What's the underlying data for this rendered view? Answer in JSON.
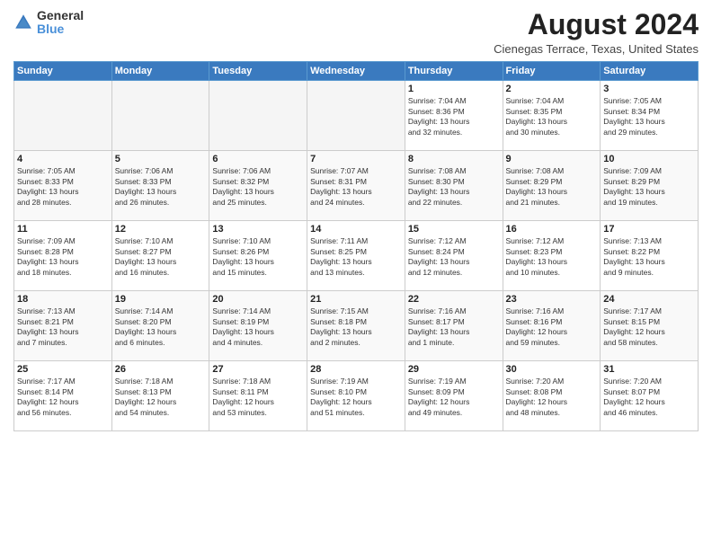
{
  "logo": {
    "general": "General",
    "blue": "Blue"
  },
  "header": {
    "month": "August 2024",
    "location": "Cienegas Terrace, Texas, United States"
  },
  "weekdays": [
    "Sunday",
    "Monday",
    "Tuesday",
    "Wednesday",
    "Thursday",
    "Friday",
    "Saturday"
  ],
  "weeks": [
    [
      {
        "day": "",
        "info": ""
      },
      {
        "day": "",
        "info": ""
      },
      {
        "day": "",
        "info": ""
      },
      {
        "day": "",
        "info": ""
      },
      {
        "day": "1",
        "info": "Sunrise: 7:04 AM\nSunset: 8:36 PM\nDaylight: 13 hours\nand 32 minutes."
      },
      {
        "day": "2",
        "info": "Sunrise: 7:04 AM\nSunset: 8:35 PM\nDaylight: 13 hours\nand 30 minutes."
      },
      {
        "day": "3",
        "info": "Sunrise: 7:05 AM\nSunset: 8:34 PM\nDaylight: 13 hours\nand 29 minutes."
      }
    ],
    [
      {
        "day": "4",
        "info": "Sunrise: 7:05 AM\nSunset: 8:33 PM\nDaylight: 13 hours\nand 28 minutes."
      },
      {
        "day": "5",
        "info": "Sunrise: 7:06 AM\nSunset: 8:33 PM\nDaylight: 13 hours\nand 26 minutes."
      },
      {
        "day": "6",
        "info": "Sunrise: 7:06 AM\nSunset: 8:32 PM\nDaylight: 13 hours\nand 25 minutes."
      },
      {
        "day": "7",
        "info": "Sunrise: 7:07 AM\nSunset: 8:31 PM\nDaylight: 13 hours\nand 24 minutes."
      },
      {
        "day": "8",
        "info": "Sunrise: 7:08 AM\nSunset: 8:30 PM\nDaylight: 13 hours\nand 22 minutes."
      },
      {
        "day": "9",
        "info": "Sunrise: 7:08 AM\nSunset: 8:29 PM\nDaylight: 13 hours\nand 21 minutes."
      },
      {
        "day": "10",
        "info": "Sunrise: 7:09 AM\nSunset: 8:29 PM\nDaylight: 13 hours\nand 19 minutes."
      }
    ],
    [
      {
        "day": "11",
        "info": "Sunrise: 7:09 AM\nSunset: 8:28 PM\nDaylight: 13 hours\nand 18 minutes."
      },
      {
        "day": "12",
        "info": "Sunrise: 7:10 AM\nSunset: 8:27 PM\nDaylight: 13 hours\nand 16 minutes."
      },
      {
        "day": "13",
        "info": "Sunrise: 7:10 AM\nSunset: 8:26 PM\nDaylight: 13 hours\nand 15 minutes."
      },
      {
        "day": "14",
        "info": "Sunrise: 7:11 AM\nSunset: 8:25 PM\nDaylight: 13 hours\nand 13 minutes."
      },
      {
        "day": "15",
        "info": "Sunrise: 7:12 AM\nSunset: 8:24 PM\nDaylight: 13 hours\nand 12 minutes."
      },
      {
        "day": "16",
        "info": "Sunrise: 7:12 AM\nSunset: 8:23 PM\nDaylight: 13 hours\nand 10 minutes."
      },
      {
        "day": "17",
        "info": "Sunrise: 7:13 AM\nSunset: 8:22 PM\nDaylight: 13 hours\nand 9 minutes."
      }
    ],
    [
      {
        "day": "18",
        "info": "Sunrise: 7:13 AM\nSunset: 8:21 PM\nDaylight: 13 hours\nand 7 minutes."
      },
      {
        "day": "19",
        "info": "Sunrise: 7:14 AM\nSunset: 8:20 PM\nDaylight: 13 hours\nand 6 minutes."
      },
      {
        "day": "20",
        "info": "Sunrise: 7:14 AM\nSunset: 8:19 PM\nDaylight: 13 hours\nand 4 minutes."
      },
      {
        "day": "21",
        "info": "Sunrise: 7:15 AM\nSunset: 8:18 PM\nDaylight: 13 hours\nand 2 minutes."
      },
      {
        "day": "22",
        "info": "Sunrise: 7:16 AM\nSunset: 8:17 PM\nDaylight: 13 hours\nand 1 minute."
      },
      {
        "day": "23",
        "info": "Sunrise: 7:16 AM\nSunset: 8:16 PM\nDaylight: 12 hours\nand 59 minutes."
      },
      {
        "day": "24",
        "info": "Sunrise: 7:17 AM\nSunset: 8:15 PM\nDaylight: 12 hours\nand 58 minutes."
      }
    ],
    [
      {
        "day": "25",
        "info": "Sunrise: 7:17 AM\nSunset: 8:14 PM\nDaylight: 12 hours\nand 56 minutes."
      },
      {
        "day": "26",
        "info": "Sunrise: 7:18 AM\nSunset: 8:13 PM\nDaylight: 12 hours\nand 54 minutes."
      },
      {
        "day": "27",
        "info": "Sunrise: 7:18 AM\nSunset: 8:11 PM\nDaylight: 12 hours\nand 53 minutes."
      },
      {
        "day": "28",
        "info": "Sunrise: 7:19 AM\nSunset: 8:10 PM\nDaylight: 12 hours\nand 51 minutes."
      },
      {
        "day": "29",
        "info": "Sunrise: 7:19 AM\nSunset: 8:09 PM\nDaylight: 12 hours\nand 49 minutes."
      },
      {
        "day": "30",
        "info": "Sunrise: 7:20 AM\nSunset: 8:08 PM\nDaylight: 12 hours\nand 48 minutes."
      },
      {
        "day": "31",
        "info": "Sunrise: 7:20 AM\nSunset: 8:07 PM\nDaylight: 12 hours\nand 46 minutes."
      }
    ]
  ]
}
